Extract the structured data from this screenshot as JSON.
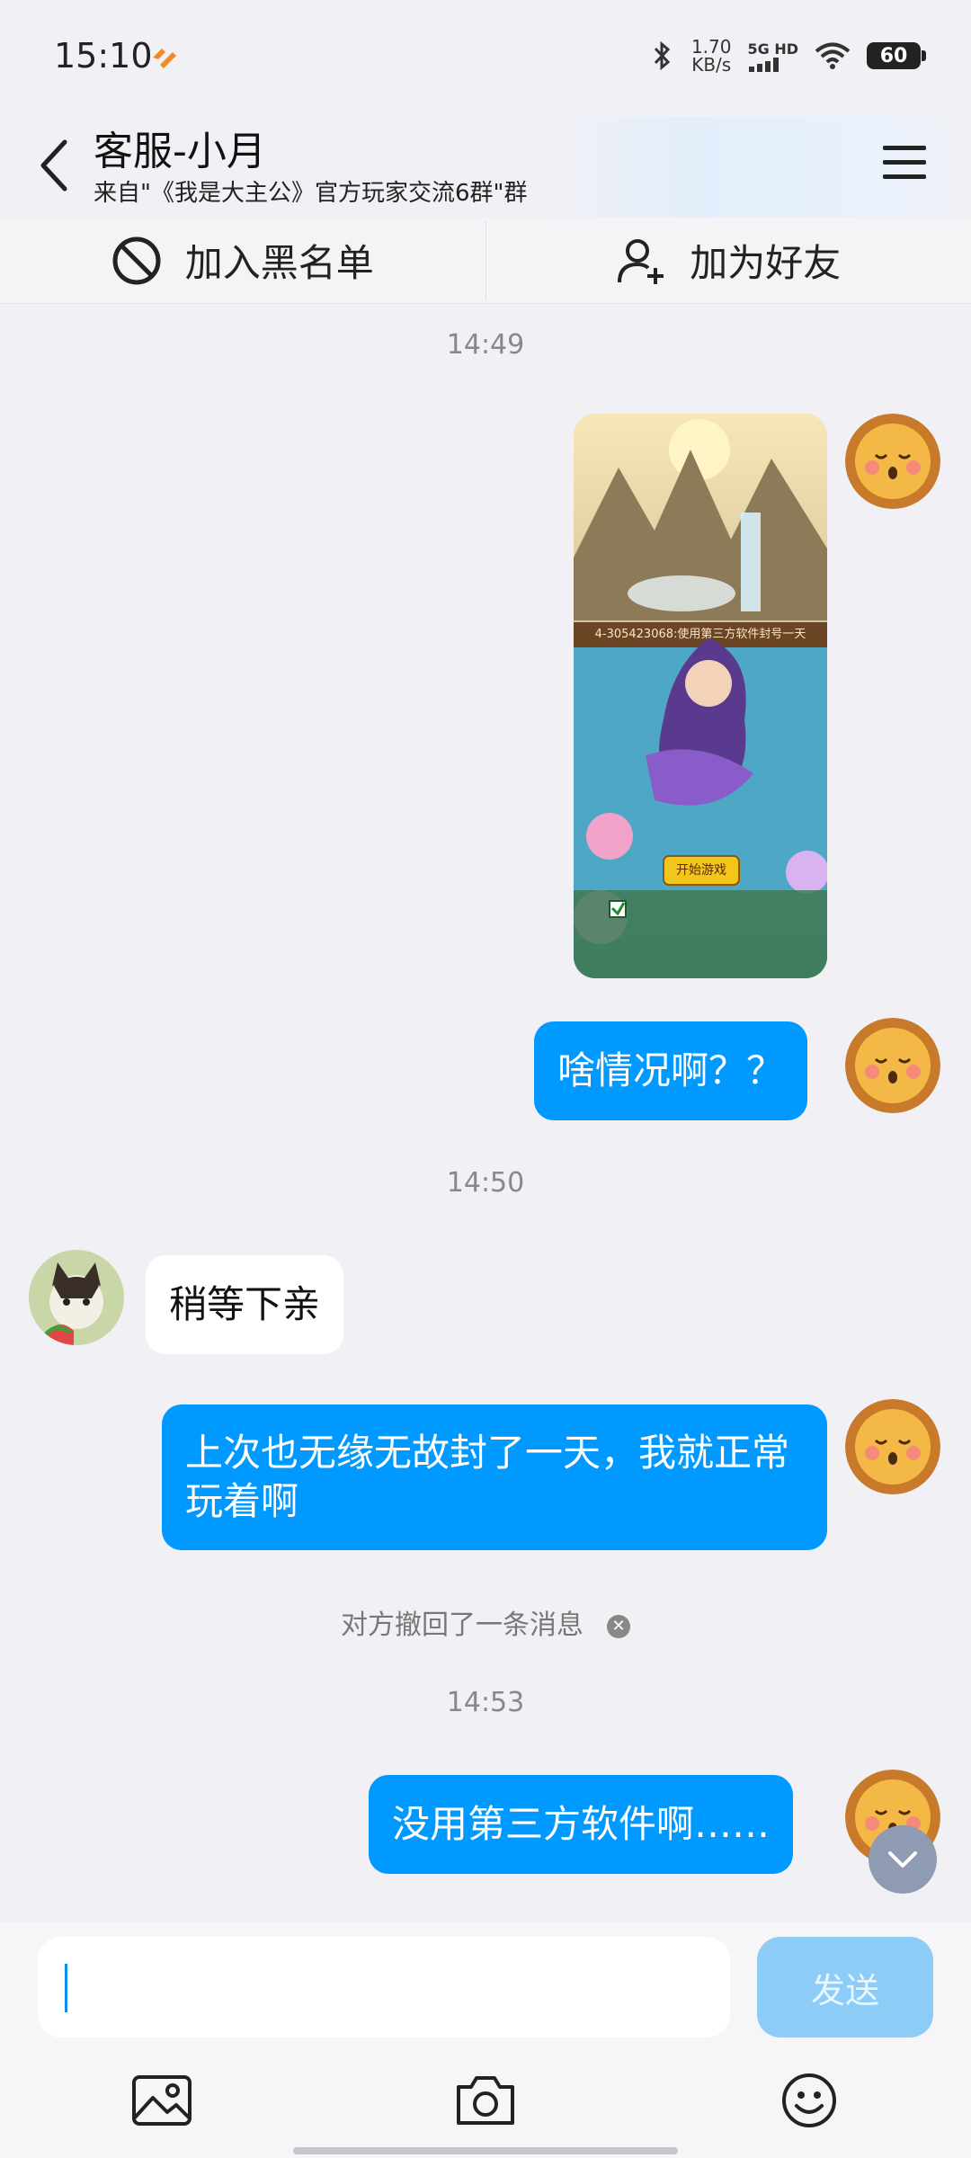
{
  "status_bar": {
    "time": "15:10",
    "net_speed_value": "1.70",
    "net_speed_unit": "KB/s",
    "network": "5G HD",
    "battery": "60"
  },
  "header": {
    "title": "客服-小月",
    "subtitle": "来自\"《我是大主公》官方玩家交流6群\"群"
  },
  "actions": {
    "blacklist": "加入黑名单",
    "add_friend": "加为好友"
  },
  "messages": {
    "time_1": "14:49",
    "image_caption": "4-305423068:使用第三方软件封号一天",
    "image_button": "开始游戏",
    "msg_1": "啥情况啊？？",
    "time_2": "14:50",
    "msg_2": "稍等下亲",
    "msg_3": "上次也无缘无故封了一天，我就正常玩着啊",
    "recall_notice": "对方撤回了一条消息",
    "time_3": "14:53",
    "msg_4": "没用第三方软件啊……"
  },
  "input": {
    "placeholder": "",
    "send_label": "发送"
  },
  "colors": {
    "my_bubble": "#0099ff",
    "other_bubble": "#ffffff",
    "background": "#f1f1f5",
    "send_disabled": "#8cccf7"
  },
  "icons": [
    "back-arrow-icon",
    "menu-icon",
    "block-icon",
    "add-friend-icon",
    "image-icon",
    "camera-icon",
    "emoji-icon",
    "chevron-down-icon"
  ]
}
